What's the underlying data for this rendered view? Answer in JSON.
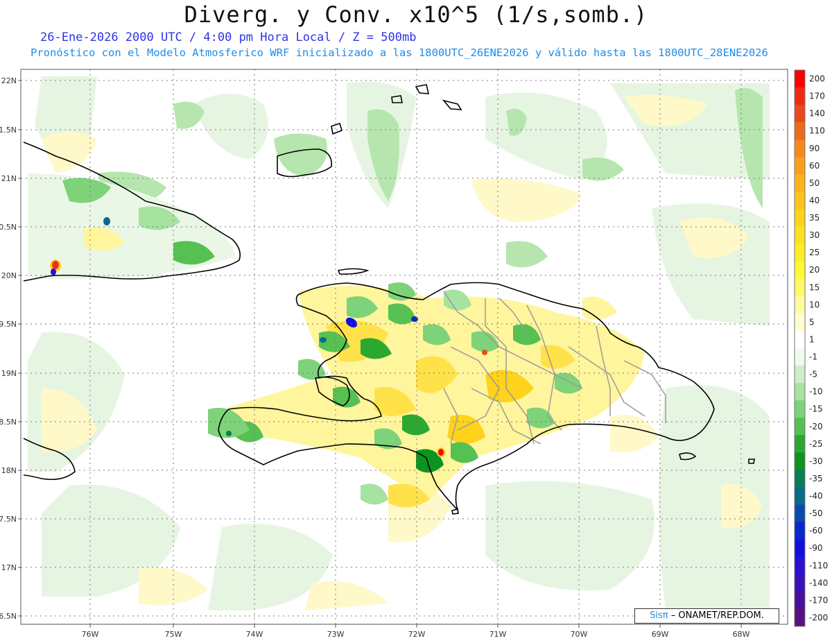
{
  "title": "Diverg. y Conv. x10^5 (1/s,somb.)",
  "subtitle_line1": "26-Ene-2026  2000 UTC / 4:00 pm Hora Local / Z = 500mb",
  "subtitle_line2": "Pronóstico con el Modelo Atmosferico WRF inicializado a las 1800UTC_26ENE2026 y válido hasta las  1800UTC_28ENE2026",
  "map": {
    "lat_labels": [
      "22N",
      "1.5N",
      "21N",
      "0.5N",
      "20N",
      "9.5N",
      "19N",
      "8.5N",
      "18N",
      "7.5N",
      "17N",
      "6.5N"
    ],
    "lon_labels": [
      "76W",
      "75W",
      "74W",
      "73W",
      "72W",
      "71W",
      "70W",
      "69W",
      "68W"
    ],
    "grid": "dotted"
  },
  "colorbar": {
    "labels": [
      "200",
      "170",
      "140",
      "110",
      "90",
      "60",
      "50",
      "40",
      "35",
      "30",
      "25",
      "20",
      "15",
      "10",
      "5",
      "1",
      "-1",
      "-5",
      "-10",
      "-15",
      "-20",
      "-25",
      "-30",
      "-35",
      "-40",
      "-50",
      "-60",
      "-90",
      "-110",
      "-140",
      "-170",
      "-200"
    ],
    "colors": [
      "#ff0000",
      "#f02a14",
      "#e84a1c",
      "#ee6a1c",
      "#f4881c",
      "#f8a01a",
      "#fcb41a",
      "#ffc41a",
      "#ffd21c",
      "#ffe020",
      "#ffee24",
      "#fff838",
      "#fffa6a",
      "#fffca0",
      "#fffed0",
      "#ffffff",
      "#f2faf0",
      "#cdeec8",
      "#a6e2a0",
      "#7ed279",
      "#56c053",
      "#2aa830",
      "#0c9420",
      "#0a7e54",
      "#0a6a8a",
      "#0a4aae",
      "#0a28cc",
      "#1010e0",
      "#2a10d0",
      "#3a10b8",
      "#4a109c",
      "#5a1082"
    ]
  },
  "credit": {
    "sis": "Sisπ",
    "text": "– ONAMET/REP.DOM."
  }
}
